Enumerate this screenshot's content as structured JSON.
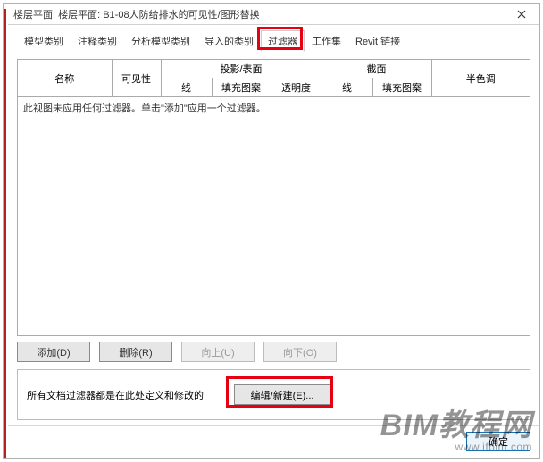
{
  "dialog": {
    "title": "楼层平面: 楼层平面: B1-08人防给排水的可见性/图形替换"
  },
  "tabs": {
    "items": [
      {
        "label": "模型类别"
      },
      {
        "label": "注释类别"
      },
      {
        "label": "分析模型类别"
      },
      {
        "label": "导入的类别"
      },
      {
        "label": "过滤器"
      },
      {
        "label": "工作集"
      },
      {
        "label": "Revit 链接"
      }
    ]
  },
  "table": {
    "headers": {
      "name": "名称",
      "visibility": "可见性",
      "projection_group": "投影/表面",
      "cut_group": "截面",
      "halftone": "半色调",
      "line": "线",
      "pattern": "填充图案",
      "transparency": "透明度"
    },
    "empty_message": "此视图未应用任何过滤器。单击\"添加\"应用一个过滤器。"
  },
  "buttons": {
    "add": "添加(D)",
    "remove": "删除(R)",
    "up": "向上(U)",
    "down": "向下(O)"
  },
  "edit_panel": {
    "caption": "所有文档过滤器都是在此处定义和修改的",
    "edit_new": "编辑/新建(E)..."
  },
  "footer": {
    "ok": "确定"
  },
  "watermark": {
    "main": "BIM教程网",
    "sub": "www.ifbim.com"
  }
}
